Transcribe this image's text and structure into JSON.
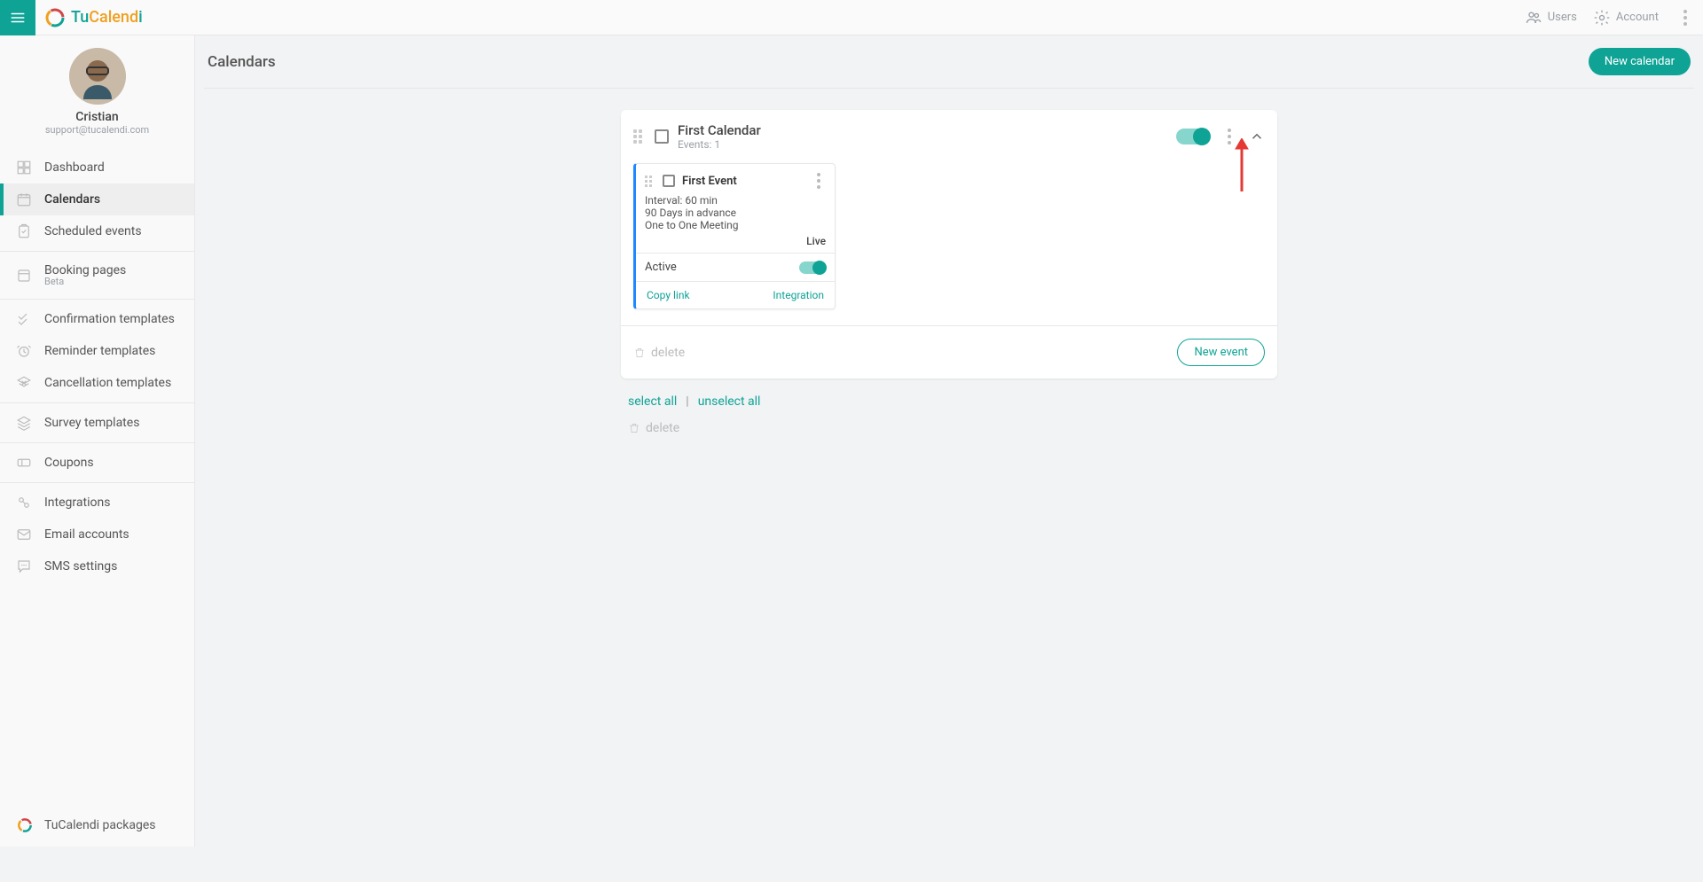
{
  "brand": {
    "part1": "Tu",
    "part2": "Calend",
    "part3": "i"
  },
  "top": {
    "users": "Users",
    "account": "Account"
  },
  "profile": {
    "name": "Cristian",
    "email": "support@tucalendi.com"
  },
  "sidebar": {
    "items": [
      {
        "label": "Dashboard"
      },
      {
        "label": "Calendars"
      },
      {
        "label": "Scheduled events"
      },
      {
        "label": "Booking pages",
        "sub": "Beta"
      },
      {
        "label": "Confirmation templates"
      },
      {
        "label": "Reminder templates"
      },
      {
        "label": "Cancellation templates"
      },
      {
        "label": "Survey templates"
      },
      {
        "label": "Coupons"
      },
      {
        "label": "Integrations"
      },
      {
        "label": "Email accounts"
      },
      {
        "label": "SMS settings"
      }
    ],
    "footer": "TuCalendi packages"
  },
  "page": {
    "title": "Calendars",
    "newCalendar": "New calendar"
  },
  "calendar": {
    "title": "First Calendar",
    "sub": "Events: 1",
    "event": {
      "title": "First Event",
      "interval": "Interval: 60 min",
      "advance": "90 Days in advance",
      "type": "One to One Meeting",
      "live": "Live",
      "activeLabel": "Active",
      "copyLink": "Copy link",
      "integration": "Integration"
    },
    "delete": "delete",
    "newEvent": "New event"
  },
  "selectRow": {
    "selectAll": "select all",
    "unselectAll": "unselect all",
    "delete": "delete"
  }
}
